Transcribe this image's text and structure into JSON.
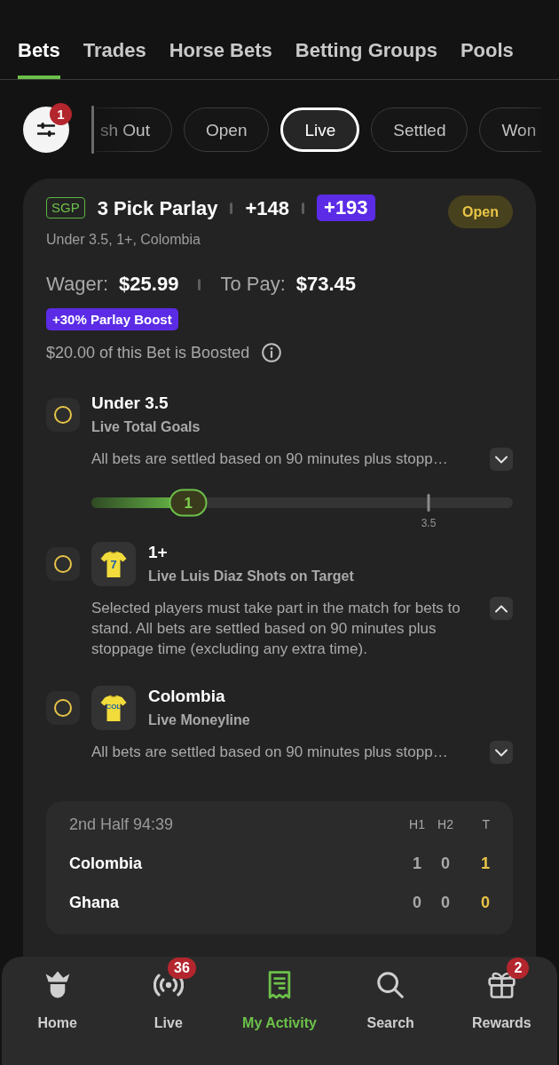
{
  "tabs": [
    {
      "label": "Bets",
      "selected": true
    },
    {
      "label": "Trades",
      "selected": false
    },
    {
      "label": "Horse Bets",
      "selected": false
    },
    {
      "label": "Betting Groups",
      "selected": false
    },
    {
      "label": "Pools",
      "selected": false
    }
  ],
  "filter_button": {
    "badge": "1"
  },
  "filters": [
    {
      "label": "sh Out",
      "selected": false
    },
    {
      "label": "Open",
      "selected": false
    },
    {
      "label": "Live",
      "selected": true
    },
    {
      "label": "Settled",
      "selected": false
    },
    {
      "label": "Won",
      "selected": false
    }
  ],
  "bet": {
    "tag": "SGP",
    "title": "3 Pick Parlay",
    "original_odds": "+148",
    "boosted_odds": "+193",
    "status": "Open",
    "selections": "Under 3.5, 1+, Colombia",
    "wager_label": "Wager:",
    "wager": "$25.99",
    "payout_label": "To Pay:",
    "payout": "$73.45",
    "boost": "+30% Parlay Boost",
    "boost_note": "$20.00 of this Bet is Boosted",
    "legs": [
      {
        "kind": "line",
        "title": "Under 3.5",
        "market": "Live Total Goals",
        "description": "All bets are settled based on 90 minutes plus stopp…",
        "expanded": false,
        "progress": {
          "level": 0.23,
          "value": "1",
          "target": {
            "level": 0.8,
            "label": "3.5"
          }
        }
      },
      {
        "kind": "player",
        "jersey_text": "7",
        "title": "1+",
        "market": "Live Luis Diaz Shots on Target",
        "description": "Selected players must take part in the match for bets to stand. All bets are settled based on 90 minutes plus stoppage time (excluding any extra time).",
        "expanded": true
      },
      {
        "kind": "team",
        "jersey_text": "COL",
        "title": "Colombia",
        "market": "Live Moneyline",
        "description": "All bets are settled based on 90 minutes plus stopp…",
        "expanded": false
      }
    ],
    "scoreboard": {
      "period": "2nd Half 94:39",
      "columns": [
        {
          "label": "H1",
          "highlighted": false
        },
        {
          "label": "H2",
          "highlighted": false
        },
        {
          "label": "T",
          "highlighted": true
        }
      ],
      "rows": [
        {
          "team": "Colombia",
          "scores": [
            "1",
            "0",
            "1"
          ]
        },
        {
          "team": "Ghana",
          "scores": [
            "0",
            "0",
            "0"
          ]
        }
      ]
    }
  },
  "nav": [
    {
      "kind": "home",
      "label": "Home",
      "selected": false
    },
    {
      "kind": "live",
      "label": "Live",
      "badge": "36",
      "selected": false
    },
    {
      "kind": "activity",
      "label": "My Activity",
      "selected": true
    },
    {
      "kind": "search",
      "label": "Search",
      "selected": false
    },
    {
      "kind": "rewards",
      "label": "Rewards",
      "badge": "2",
      "selected": false
    }
  ]
}
